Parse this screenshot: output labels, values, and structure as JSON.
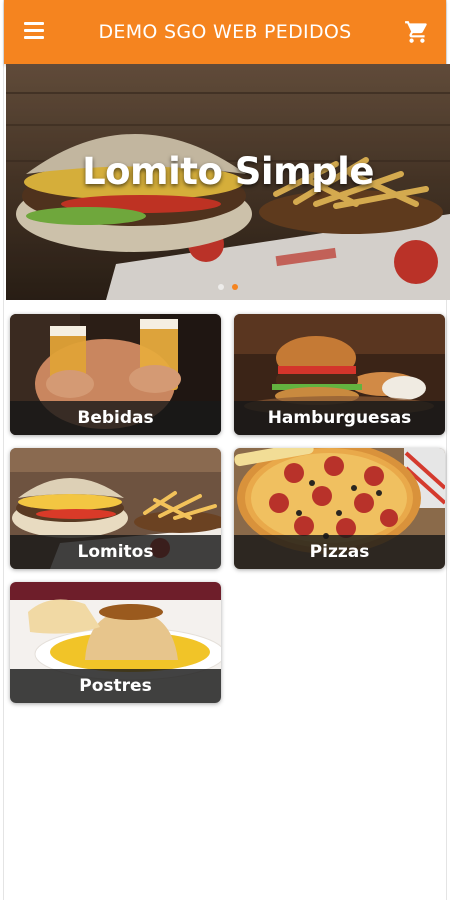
{
  "appbar": {
    "title": "DEMO SGO WEB PEDIDOS",
    "menu_icon": "menu-icon",
    "cart_icon": "cart-icon",
    "color": "#f5841f"
  },
  "banner": {
    "title": "Lomito Simple",
    "slides_total": 2,
    "active_slide": 2
  },
  "categories": [
    {
      "label": "Bebidas"
    },
    {
      "label": "Hamburguesas"
    },
    {
      "label": "Lomitos"
    },
    {
      "label": "Pizzas"
    },
    {
      "label": "Postres"
    }
  ]
}
